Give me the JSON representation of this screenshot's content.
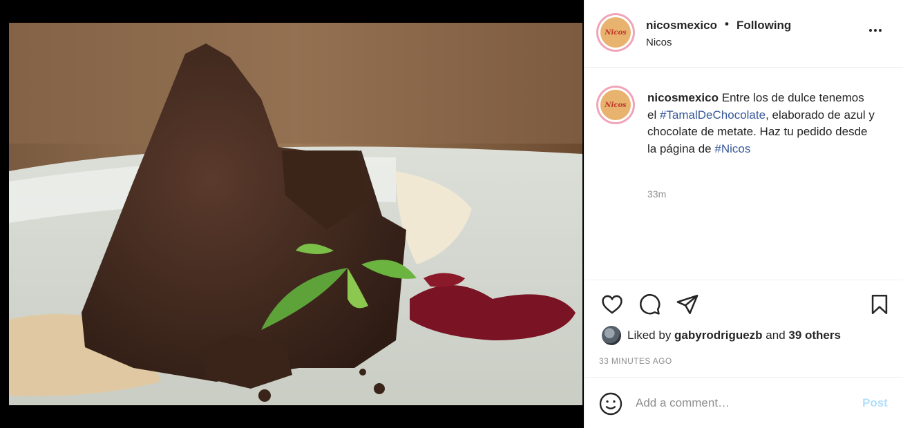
{
  "post": {
    "username": "nicosmexico",
    "separator": "•",
    "follow_label": "Following",
    "location": "Nicos",
    "avatar_logo": "Nicos",
    "more_icon": "more-horizontal-icon"
  },
  "caption": {
    "username": "nicosmexico",
    "text_1": "Entre los de dulce tenemos el ",
    "hashtag_1": "#TamalDeChocolate",
    "text_2": ", elaborado de azul y chocolate de metate. Haz tu pedido desde la página de ",
    "hashtag_2": "#Nicos",
    "time": "33m"
  },
  "actions": {
    "like_icon": "heart-icon",
    "comment_icon": "comment-icon",
    "share_icon": "send-icon",
    "save_icon": "bookmark-icon"
  },
  "likes": {
    "prefix": "Liked by ",
    "user": "gabyrodriguezb",
    "middle": " and ",
    "others": "39 others"
  },
  "timestamp": "33 MINUTES AGO",
  "comment": {
    "emoji_icon": "smiley-icon",
    "placeholder": "Add a comment…",
    "post_label": "Post"
  },
  "colors": {
    "hashtag": "#385898",
    "post_button": "#b2dffc",
    "meta_gray": "#8e8e8e"
  }
}
